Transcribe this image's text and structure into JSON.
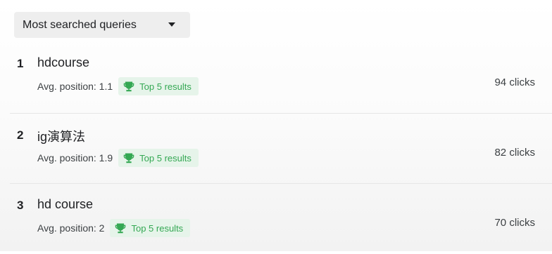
{
  "filter": {
    "label": "Most searched queries",
    "caret": "caret-down-icon"
  },
  "colors": {
    "badge_bg": "#e6f4ea",
    "badge_fg": "#34a853"
  },
  "queries": [
    {
      "rank": "1",
      "query": "hdcourse",
      "avg_position": "Avg. position: 1.1",
      "badge": "Top 5 results",
      "clicks": "94 clicks"
    },
    {
      "rank": "2",
      "query": "ig演算法",
      "avg_position": "Avg. position: 1.9",
      "badge": "Top 5 results",
      "clicks": "82 clicks"
    },
    {
      "rank": "3",
      "query": "hd course",
      "avg_position": "Avg. position: 2",
      "badge": "Top 5 results",
      "clicks": "70 clicks"
    }
  ]
}
